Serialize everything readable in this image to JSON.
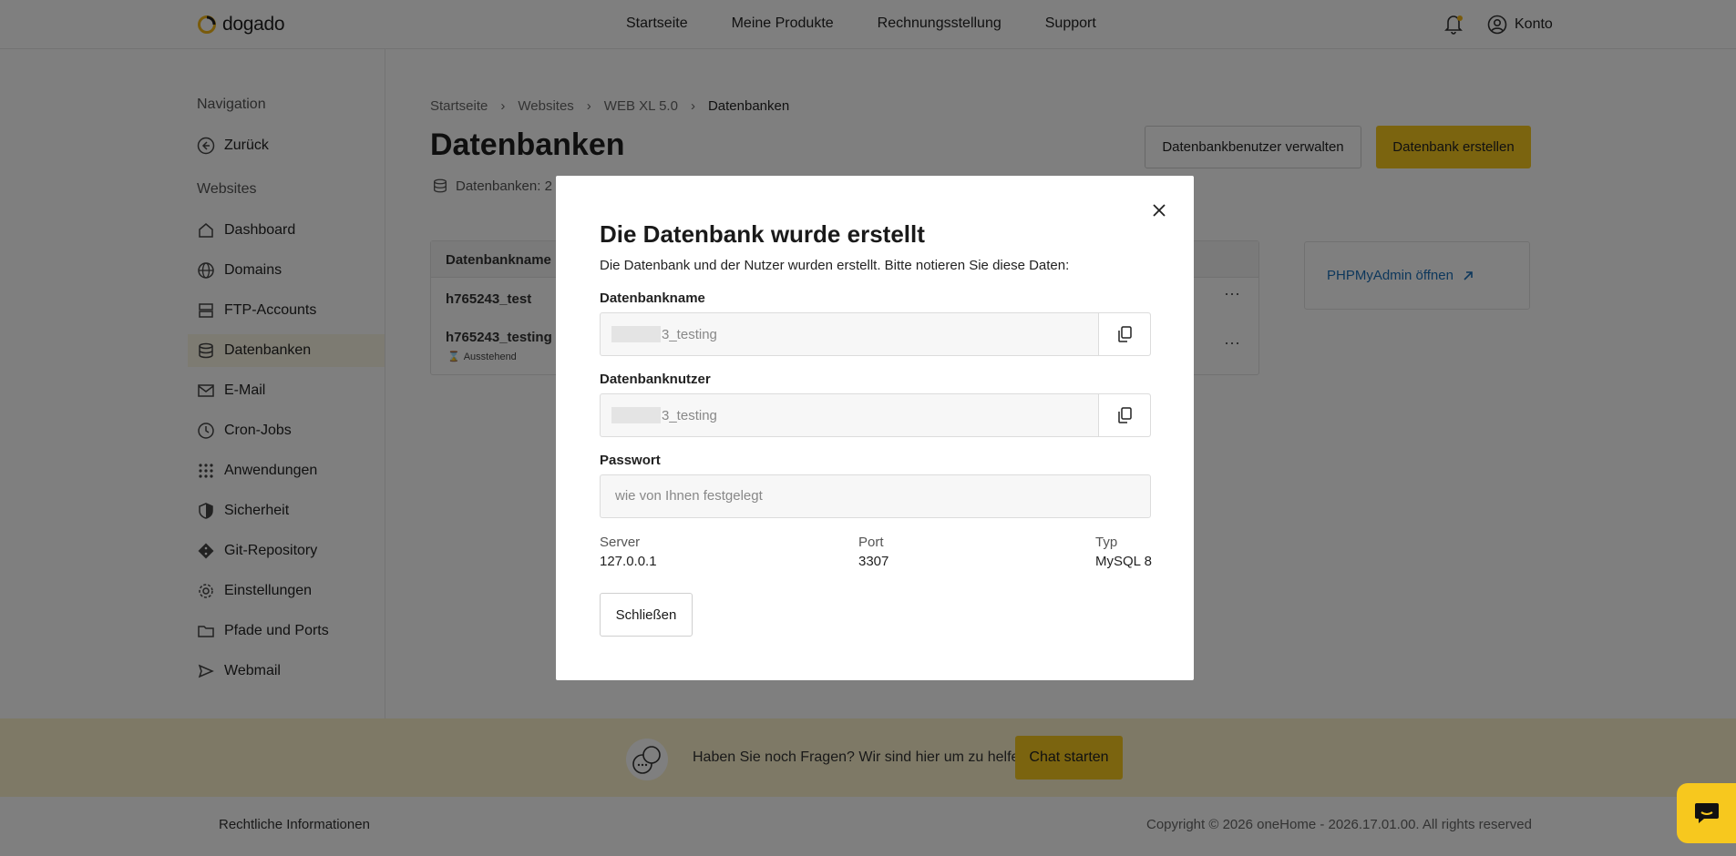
{
  "header": {
    "brand": "dogado",
    "nav": [
      "Startseite",
      "Meine Produkte",
      "Rechnungsstellung",
      "Support"
    ],
    "account_label": "Konto",
    "accent_color": "#f7c81e"
  },
  "sidebar": {
    "nav_heading": "Navigation",
    "back_label": "Zurück",
    "section_heading": "Websites",
    "items": [
      {
        "label": "Dashboard",
        "icon": "home-icon"
      },
      {
        "label": "Domains",
        "icon": "globe-icon"
      },
      {
        "label": "FTP-Accounts",
        "icon": "server-icon"
      },
      {
        "label": "Datenbanken",
        "icon": "database-icon",
        "active": true
      },
      {
        "label": "E-Mail",
        "icon": "mail-icon"
      },
      {
        "label": "Cron-Jobs",
        "icon": "clock-icon"
      },
      {
        "label": "Anwendungen",
        "icon": "grid-icon"
      },
      {
        "label": "Sicherheit",
        "icon": "shield-icon"
      },
      {
        "label": "Git-Repository",
        "icon": "git-icon"
      },
      {
        "label": "Einstellungen",
        "icon": "gear-icon"
      },
      {
        "label": "Pfade und Ports",
        "icon": "folder-icon"
      },
      {
        "label": "Webmail",
        "icon": "send-icon"
      }
    ]
  },
  "main": {
    "breadcrumb": [
      "Startseite",
      "Websites",
      "WEB XL 5.0",
      "Datenbanken"
    ],
    "title": "Datenbanken",
    "manage_users_button": "Datenbankbenutzer verwalten",
    "create_db_button": "Datenbank erstellen",
    "db_count": "Datenbanken: 2",
    "table": {
      "column_header": "Datenbankname",
      "rows": [
        {
          "name": "h765243_test"
        },
        {
          "name": "h765243_testing",
          "status": "Ausstehend"
        }
      ]
    },
    "phpmyadmin_link": "PHPMyAdmin öffnen"
  },
  "footer": {
    "help_text": "Haben Sie noch Fragen? Wir sind hier um zu helfen.",
    "chat_button": "Chat starten",
    "legal": "Rechtliche Informationen",
    "copyright": "Copyright © 2026 oneHome - 2026.17.01.00. All rights reserved"
  },
  "modal": {
    "title": "Die Datenbank wurde erstellt",
    "description": "Die Datenbank und der Nutzer wurden erstellt. Bitte notieren Sie diese Daten:",
    "db_name_label": "Datenbankname",
    "db_name_value": "3_testing",
    "db_user_label": "Datenbanknutzer",
    "db_user_value": "3_testing",
    "password_label": "Passwort",
    "password_placeholder": "wie von Ihnen festgelegt",
    "server_label": "Server",
    "server_value": "127.0.0.1",
    "port_label": "Port",
    "port_value": "3307",
    "type_label": "Typ",
    "type_value": "MySQL 8",
    "close_button": "Schließen"
  }
}
